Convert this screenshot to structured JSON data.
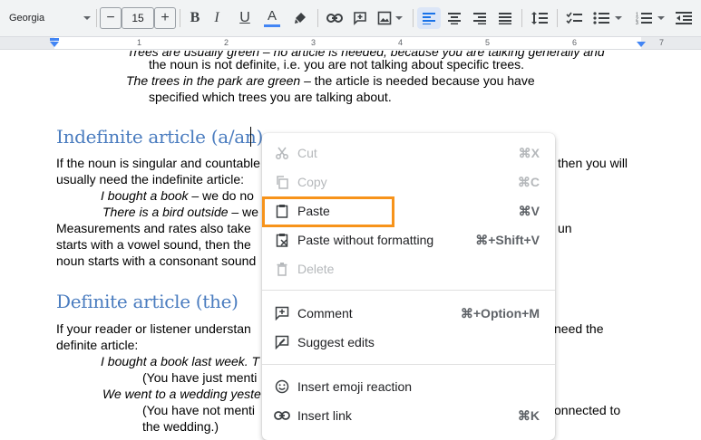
{
  "toolbar": {
    "font_name": "Georgia",
    "font_size": "15",
    "minus": "−",
    "plus": "+",
    "bold": "B",
    "italic": "I",
    "underline": "U",
    "text_color": "A",
    "text_color_swatch": "#4285f4"
  },
  "ruler": {
    "numbers": [
      "1",
      "2",
      "3",
      "4",
      "5",
      "6",
      "7"
    ]
  },
  "document": {
    "lines": [
      "Trees are usually green – no article is needed, because you are talking generally and",
      "the noun is not definite, i.e. you are not talking about specific trees.",
      "The trees in the park are green",
      " – the article is needed because you have",
      "specified  which trees you are talking about.",
      "Indefinite article (a/an)",
      "If the noun is singular and countable",
      "then you will",
      "usually need the indefinite article:",
      "I bought a book",
      " – we do no",
      "There is a bird outside",
      " – we",
      "Measurements and rates also take",
      "un",
      "starts with a vowel sound, then the",
      "noun starts with a consonant sound",
      "Definite article (the)",
      "If your reader or listener understan",
      "need the",
      "definite article:",
      "I bought a book last week. T",
      "(You have just menti",
      "We went to a wedding yeste",
      "(You have not menti",
      "onnected to",
      "the wedding.)"
    ]
  },
  "context_menu": {
    "items": [
      {
        "label": "Cut",
        "shortcut": "⌘X",
        "icon": "scissors-icon",
        "enabled": false
      },
      {
        "label": "Copy",
        "shortcut": "⌘C",
        "icon": "copy-icon",
        "enabled": false
      },
      {
        "label": "Paste",
        "shortcut": "⌘V",
        "icon": "clipboard-icon",
        "enabled": true
      },
      {
        "label": "Paste without formatting",
        "shortcut": "⌘+Shift+V",
        "icon": "clipboard-clear-format-icon",
        "enabled": true
      },
      {
        "label": "Delete",
        "shortcut": "",
        "icon": "trash-icon",
        "enabled": false
      },
      {
        "label": "Comment",
        "shortcut": "⌘+Option+M",
        "icon": "add-comment-icon",
        "enabled": true
      },
      {
        "label": "Suggest edits",
        "shortcut": "",
        "icon": "suggest-edit-icon",
        "enabled": true
      },
      {
        "label": "Insert emoji reaction",
        "shortcut": "",
        "icon": "emoji-icon",
        "enabled": true
      },
      {
        "label": "Insert link",
        "shortcut": "⌘K",
        "icon": "link-icon",
        "enabled": true
      }
    ]
  },
  "colors": {
    "heading": "#4a7cbf",
    "highlight": "#f7931a",
    "toolbar_bg": "#f1f3f4",
    "accent": "#4285f4"
  }
}
